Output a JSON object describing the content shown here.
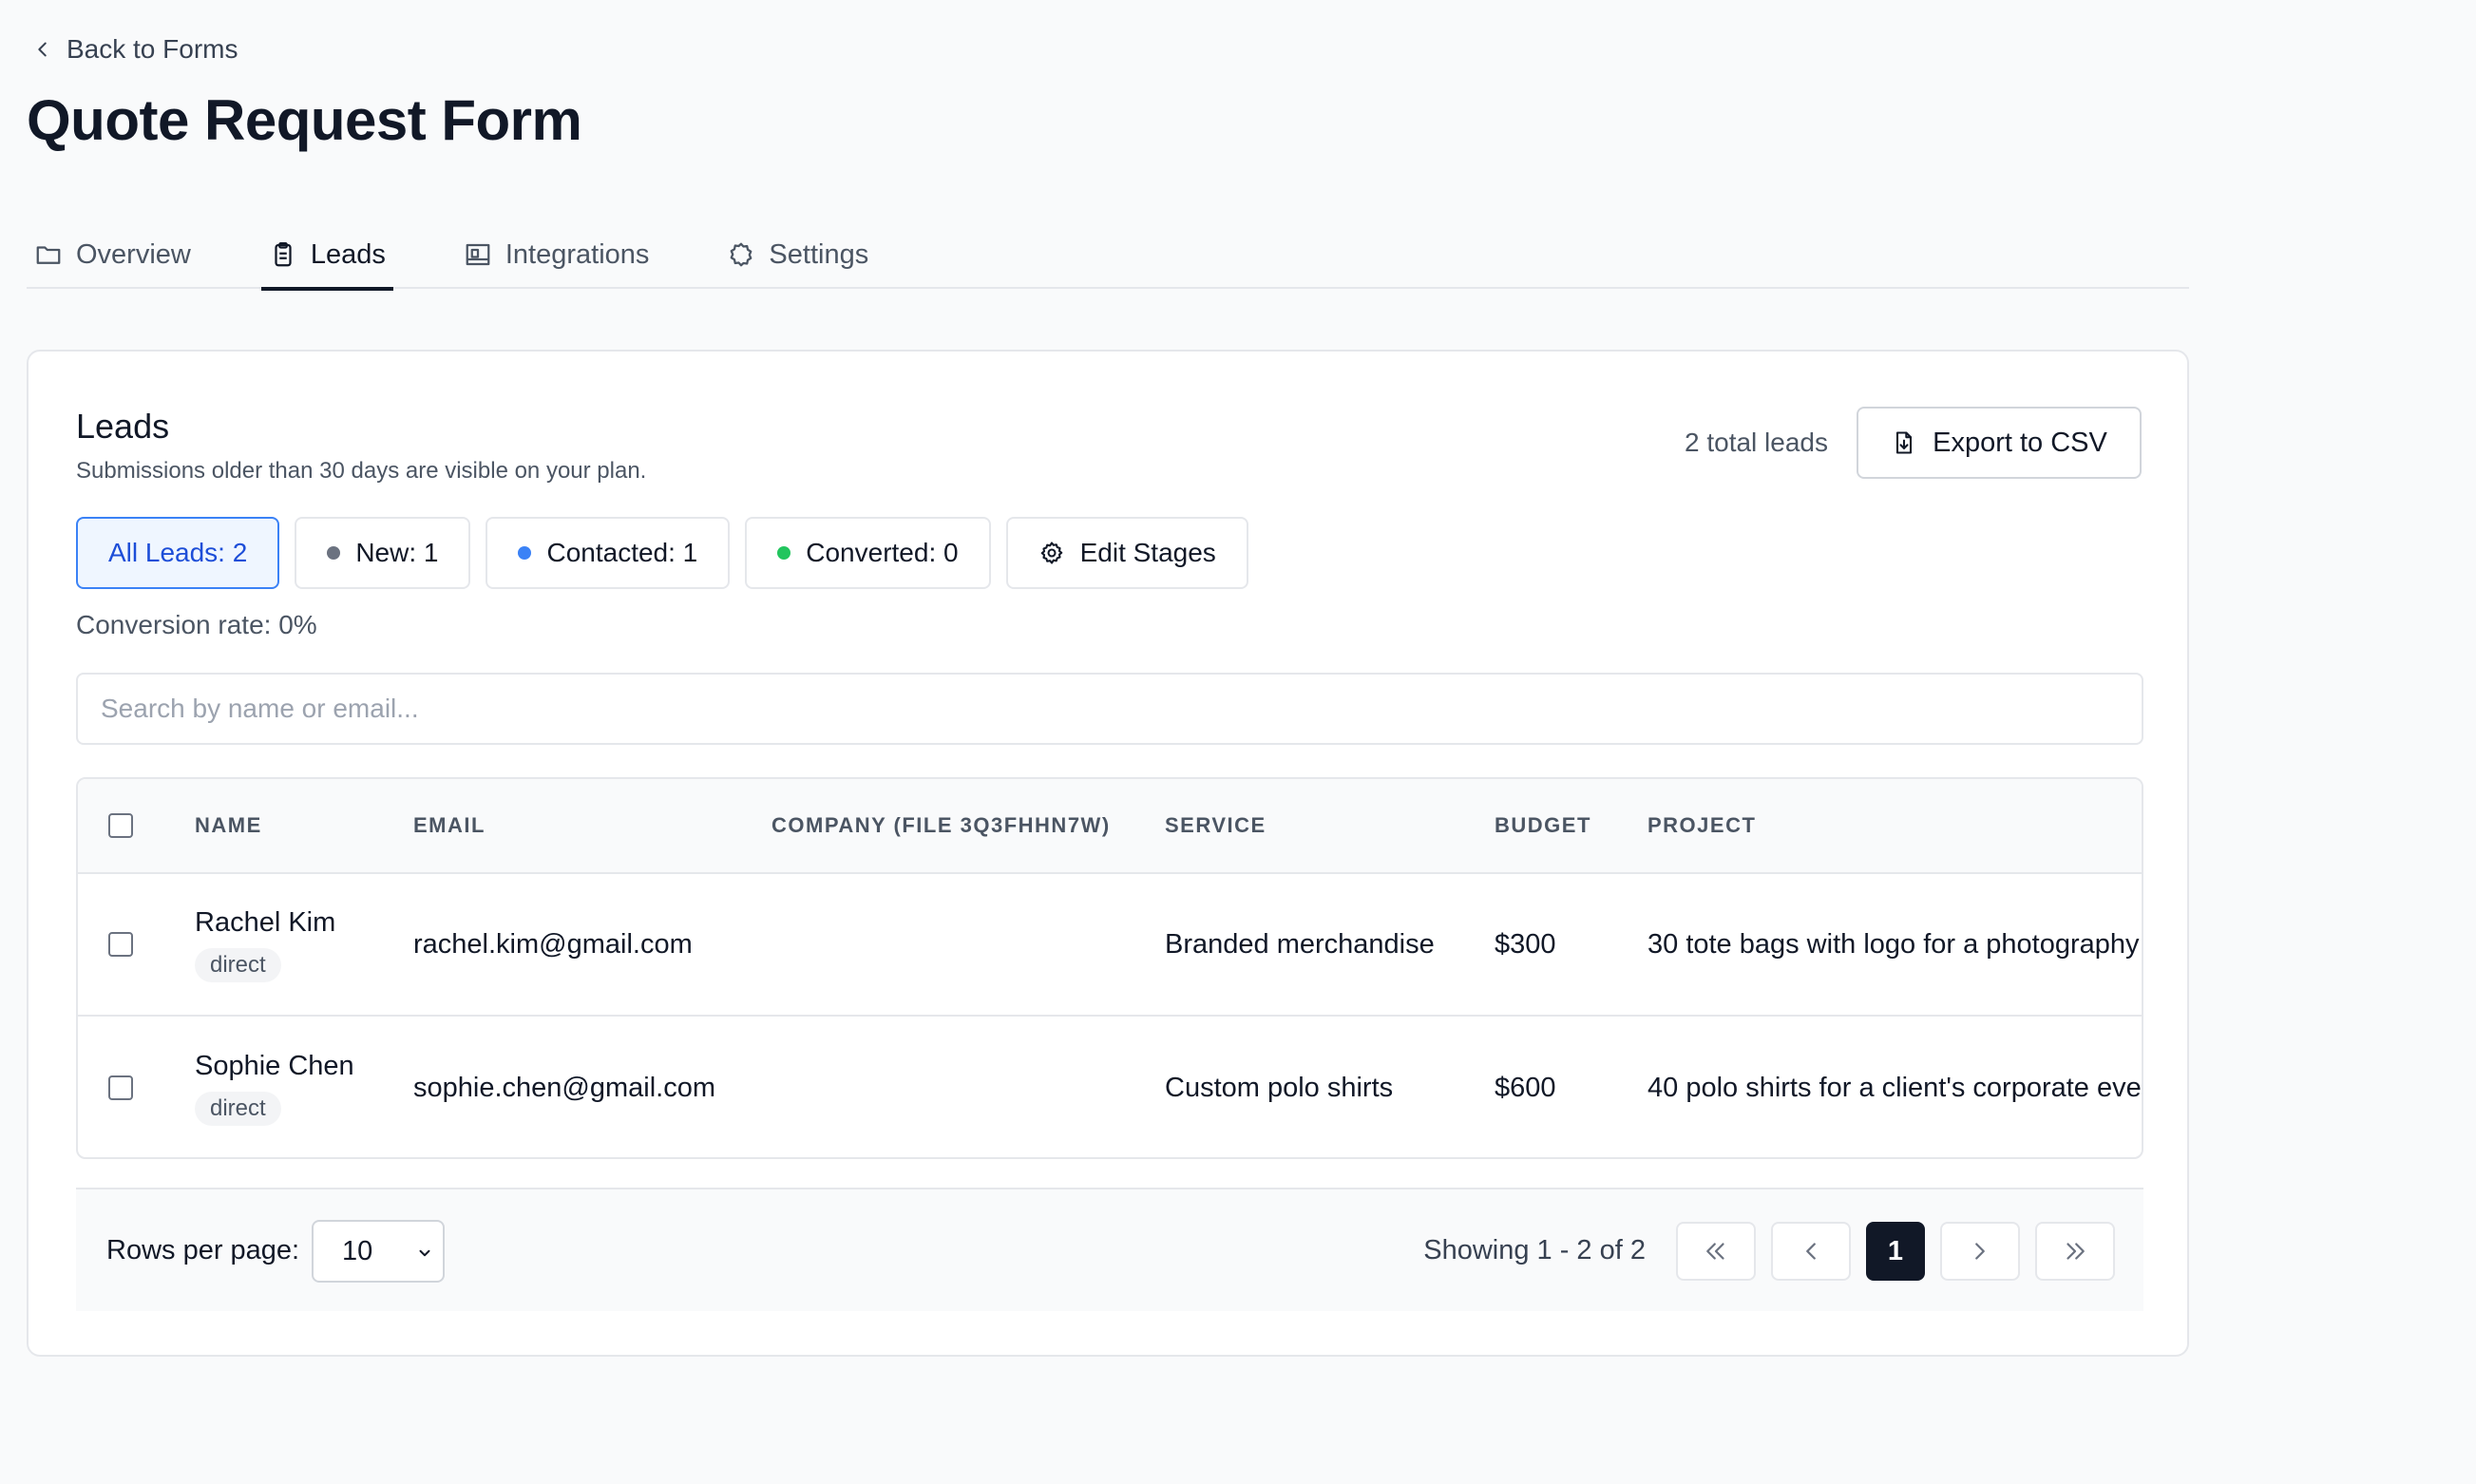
{
  "nav": {
    "back_label": "Back to Forms"
  },
  "page": {
    "title": "Quote Request Form"
  },
  "tabs": [
    {
      "label": "Overview",
      "icon": "folder-icon"
    },
    {
      "label": "Leads",
      "icon": "clipboard-icon"
    },
    {
      "label": "Integrations",
      "icon": "integrations-icon"
    },
    {
      "label": "Settings",
      "icon": "settings-icon"
    }
  ],
  "leads": {
    "title": "Leads",
    "subtitle": "Submissions older than 30 days are visible on your plan.",
    "total_label": "2 total leads",
    "export_label": "Export to CSV",
    "filters": [
      {
        "label": "All Leads: 2"
      },
      {
        "label": "New: 1",
        "color": "#6b7280"
      },
      {
        "label": "Contacted: 1",
        "color": "#3b82f6"
      },
      {
        "label": "Converted: 0",
        "color": "#22c55e"
      }
    ],
    "edit_stages_label": "Edit Stages",
    "conversion_rate": "Conversion rate: 0%",
    "search_placeholder": "Search by name or email..."
  },
  "table": {
    "columns": [
      "NAME",
      "EMAIL",
      "COMPANY (FILE 3Q3FHHN7W)",
      "SERVICE",
      "BUDGET",
      "PROJECT"
    ],
    "rows": [
      {
        "name": "Rachel Kim",
        "source": "direct",
        "email": "rachel.kim@gmail.com",
        "company": "",
        "service": "Branded merchandise",
        "budget": "$300",
        "project": "30 tote bags with logo for a photography"
      },
      {
        "name": "Sophie Chen",
        "source": "direct",
        "email": "sophie.chen@gmail.com",
        "company": "",
        "service": "Custom polo shirts",
        "budget": "$600",
        "project": "40 polo shirts for a client's corporate eve"
      }
    ]
  },
  "pagination": {
    "rows_per_page_label": "Rows per page:",
    "rows_per_page_value": "10",
    "showing": "Showing 1 - 2 of 2",
    "current_page": "1"
  },
  "colors": {
    "accent": "#3b82f6",
    "active_dark": "#111827"
  }
}
